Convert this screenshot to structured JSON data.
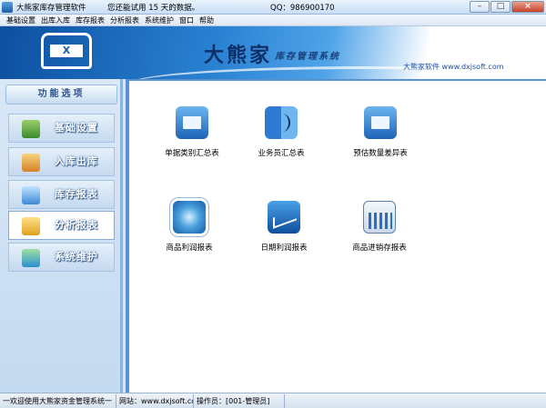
{
  "window": {
    "title": "大熊家库存管理软件",
    "trial_notice": "您还能试用 15 天的数据。",
    "qq": "QQ：986900170"
  },
  "menu": [
    "基础设置",
    "出库入库",
    "库存报表",
    "分析报表",
    "系统维护",
    "窗口",
    "帮助"
  ],
  "banner": {
    "logo_letter": "X",
    "title": "大熊家",
    "subtitle": "库存管理系统",
    "company": "大熊家软件  www.dxjsoft.com"
  },
  "sidebar": {
    "header": "功能选项",
    "items": [
      {
        "label": "基础设置",
        "icon": "settings-icon",
        "active": false
      },
      {
        "label": "入库出库",
        "icon": "warehouse-icon",
        "active": false
      },
      {
        "label": "库存报表",
        "icon": "stack-icon",
        "active": false
      },
      {
        "label": "分析报表",
        "icon": "analysis-icon",
        "active": true
      },
      {
        "label": "系统维护",
        "icon": "system-icon",
        "active": false
      }
    ]
  },
  "main": {
    "tiles": [
      {
        "label": "单据类别汇总表",
        "icon": "mail-icon"
      },
      {
        "label": "业务员汇总表",
        "icon": "finder-icon"
      },
      {
        "label": "预估数量差异表",
        "icon": "mail-icon"
      },
      {
        "label": "商品利润报表",
        "icon": "compass-icon"
      },
      {
        "label": "日期利润报表",
        "icon": "line-chart-icon"
      },
      {
        "label": "商品进销存报表",
        "icon": "bar-chart-icon"
      }
    ]
  },
  "status": {
    "marquee": "一欢迎使用大熊家资金管理系统一",
    "website": "网站：www.dxjsoft.com",
    "operator": "操作员：[001-管理员]"
  },
  "colors": {
    "accent": "#5d90cf",
    "banner_dark": "#0d4fa0"
  }
}
